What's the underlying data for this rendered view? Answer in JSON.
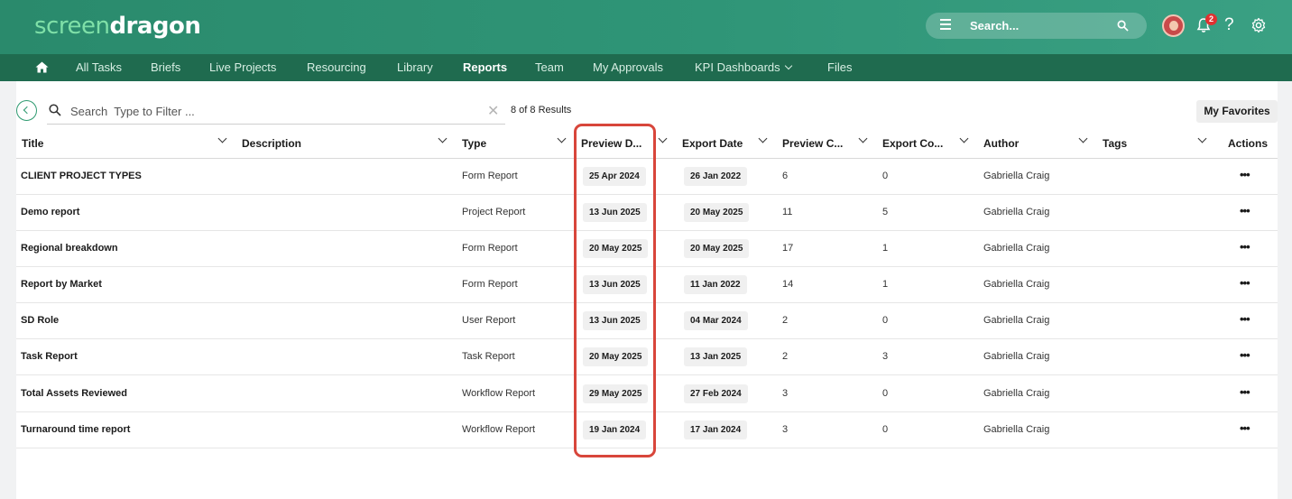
{
  "header": {
    "logo_part1": "screen",
    "logo_part2": "dragon",
    "search_placeholder": "Search...",
    "notification_count": "2",
    "help_label": "?"
  },
  "nav": {
    "items": [
      {
        "label": "All Tasks"
      },
      {
        "label": "Briefs"
      },
      {
        "label": "Live Projects"
      },
      {
        "label": "Resourcing"
      },
      {
        "label": "Library"
      },
      {
        "label": "Reports",
        "active": true
      },
      {
        "label": "Team"
      },
      {
        "label": "My Approvals"
      },
      {
        "label": "KPI Dashboards"
      },
      {
        "label": "Files"
      }
    ]
  },
  "toolbar": {
    "filter_label": "Search",
    "filter_placeholder": "Type to Filter ...",
    "clear_label": "✕",
    "results": "8 of 8 Results",
    "favorites_label": "My Favorites"
  },
  "table": {
    "columns": [
      "Title",
      "Description",
      "Type",
      "Preview D...",
      "Export Date",
      "Preview C...",
      "Export Co...",
      "Author",
      "Tags",
      "Actions"
    ],
    "rows": [
      {
        "title": "CLIENT PROJECT TYPES",
        "description": "",
        "type": "Form Report",
        "preview_date": "25 Apr 2024",
        "export_date": "26 Jan 2022",
        "preview_count": "6",
        "export_count": "0",
        "author": "Gabriella Craig",
        "tags": "",
        "actions": "•••"
      },
      {
        "title": "Demo report",
        "description": "",
        "type": "Project Report",
        "preview_date": "13 Jun 2025",
        "export_date": "20 May 2025",
        "preview_count": "11",
        "export_count": "5",
        "author": "Gabriella Craig",
        "tags": "",
        "actions": "•••"
      },
      {
        "title": "Regional breakdown",
        "description": "",
        "type": "Form Report",
        "preview_date": "20 May 2025",
        "export_date": "20 May 2025",
        "preview_count": "17",
        "export_count": "1",
        "author": "Gabriella Craig",
        "tags": "",
        "actions": "•••"
      },
      {
        "title": "Report by Market",
        "description": "",
        "type": "Form Report",
        "preview_date": "13 Jun 2025",
        "export_date": "11 Jan 2022",
        "preview_count": "14",
        "export_count": "1",
        "author": "Gabriella Craig",
        "tags": "",
        "actions": "•••"
      },
      {
        "title": "SD Role",
        "description": "",
        "type": "User Report",
        "preview_date": "13 Jun 2025",
        "export_date": "04 Mar 2024",
        "preview_count": "2",
        "export_count": "0",
        "author": "Gabriella Craig",
        "tags": "",
        "actions": "•••"
      },
      {
        "title": "Task Report",
        "description": "",
        "type": "Task Report",
        "preview_date": "20 May 2025",
        "export_date": "13 Jan 2025",
        "preview_count": "2",
        "export_count": "3",
        "author": "Gabriella Craig",
        "tags": "",
        "actions": "•••"
      },
      {
        "title": "Total Assets Reviewed",
        "description": "",
        "type": "Workflow Report",
        "preview_date": "29 May 2025",
        "export_date": "27 Feb 2024",
        "preview_count": "3",
        "export_count": "0",
        "author": "Gabriella Craig",
        "tags": "",
        "actions": "•••"
      },
      {
        "title": "Turnaround time report",
        "description": "",
        "type": "Workflow Report",
        "preview_date": "19 Jan 2024",
        "export_date": "17 Jan 2024",
        "preview_count": "3",
        "export_count": "0",
        "author": "Gabriella Craig",
        "tags": "",
        "actions": "•••"
      }
    ]
  },
  "colors": {
    "brand_green": "#2b8a6e",
    "nav_green": "#1f6b4f",
    "highlight_red": "#d8463b"
  }
}
